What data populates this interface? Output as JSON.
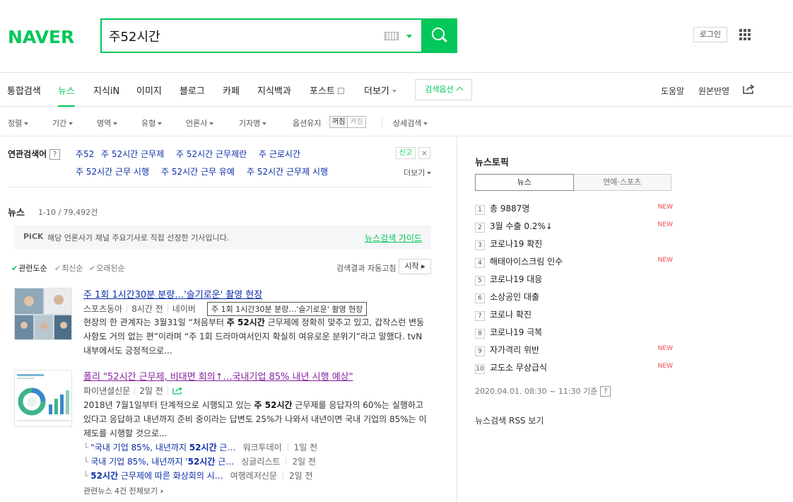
{
  "header": {
    "logo": "NAVER",
    "search_value": "주52시간",
    "login_label": "로그인"
  },
  "tabs": {
    "items": [
      "통합검색",
      "뉴스",
      "지식iN",
      "이미지",
      "블로그",
      "카페",
      "지식백과",
      "포스트",
      "더보기"
    ],
    "active": "뉴스",
    "options_label": "검색옵션",
    "help_label": "도움말",
    "original_label": "원본반영"
  },
  "filters": {
    "items": [
      "정렬",
      "기간",
      "영역",
      "유형",
      "언론사",
      "기자명"
    ],
    "option_keep": "옵션유지",
    "toggle_on": "꺼짐",
    "toggle_off": "켜짐",
    "detail": "상세검색"
  },
  "related": {
    "label": "연관검색어",
    "help": "?",
    "keywords_row1": [
      "주52",
      "주 52시간 근무제",
      "주 52시간 근무제란",
      "주 근로시간"
    ],
    "keywords_row2": [
      "주 52시간 근무 시행",
      "주 52시간 근무 유예",
      "주 52시간 근무제 시행"
    ],
    "report": "신고",
    "close": "×",
    "more": "더보기"
  },
  "news_section": {
    "title": "뉴스",
    "count": "1-10 / 79,492건",
    "pick_badge": "PiCK",
    "pick_text": "해당 언론사가 채널 주요기사로 직접 선정한 기사입니다.",
    "guide_link": "뉴스검색 가이드",
    "sort": [
      "관련도순",
      "최신순",
      "오래된순"
    ],
    "autoplay": "검색결과 자동고침",
    "start": "시작"
  },
  "articles": [
    {
      "title": "주 1회 1시간30분 분량…'슬기로운' 촬영 현장",
      "source": "스포츠동아",
      "time": "8시간 전",
      "extra": "네이버",
      "tooltip": "주 1회 1시간30분 분량…'슬기로운' 촬영 현장",
      "body_pre": "현장의 한 관계자는 3월31일 “처음부터 ",
      "body_bold": "주 52시간",
      "body_post": " 근무제에 정확히 맞추고 있고, 갑작스런 변동사항도 거의 없는 편”이라며 “주 1회 드라마여서인지 확실히 여유로운 분위기”라고 말했다. tvN 내부에서도 긍정적으로..."
    },
    {
      "title": "폴리 \"52시간 근무제, 비대면 회의↑…국내기업 85% 내년 시행 예상\"",
      "source": "파이낸셜신문",
      "time": "2일 전",
      "body_pre": "2018년 7월1일부터 단계적으로 시행되고 있는 ",
      "body_bold": "주 52시간",
      "body_post": " 근무제를 응답자의 60%는 실행하고 있다고 응답하고 내년까지 준비 중이라는 답변도 25%가 나와서 내년이면 국내 기업의 85%는 이 제도를 시행할 것으로...",
      "subs": [
        {
          "pre": "\"국내 기업 85%, 내년까지 ",
          "bold": "52시간",
          "post": " 근…",
          "src": "워크투데이",
          "time": "1일 전"
        },
        {
          "pre": "국내 기업 85%, 내년까지 '",
          "bold": "52시간",
          "post": " 근…",
          "src": "싱글리스트",
          "time": "2일 전"
        },
        {
          "pre": "",
          "bold": "52시간",
          "post": " 근무제에 따른 화상회의 시…",
          "src": "여행레저신문",
          "time": "2일 전"
        }
      ],
      "related_all": "관련뉴스 4건 전체보기"
    }
  ],
  "news_topic": {
    "title": "뉴스토픽",
    "tabs": [
      "뉴스",
      "연예·스포츠"
    ],
    "items": [
      {
        "num": "1",
        "text": "총 9887명",
        "badge": "NEW"
      },
      {
        "num": "2",
        "text": "3월 수출 0.2%↓",
        "badge": "NEW"
      },
      {
        "num": "3",
        "text": "코로나19 확진",
        "badge": ""
      },
      {
        "num": "4",
        "text": "해태아이스크림 인수",
        "badge": "NEW"
      },
      {
        "num": "5",
        "text": "코로나19 대응",
        "badge": ""
      },
      {
        "num": "6",
        "text": "소상공인 대출",
        "badge": ""
      },
      {
        "num": "7",
        "text": "코로나 확진",
        "badge": ""
      },
      {
        "num": "8",
        "text": "코로나19 극복",
        "badge": ""
      },
      {
        "num": "9",
        "text": "자가격리 위반",
        "badge": "NEW"
      },
      {
        "num": "10",
        "text": "교도소 무상급식",
        "badge": "NEW"
      }
    ],
    "time": "2020.04.01. 08:30 ~ 11:30 기준",
    "help": "?",
    "rss": "뉴스검색 RSS 보기"
  },
  "colors": {
    "brand": "#03c75a",
    "link": "#0b2ea8",
    "visited": "#8623a1",
    "new": "#f04a4a"
  }
}
